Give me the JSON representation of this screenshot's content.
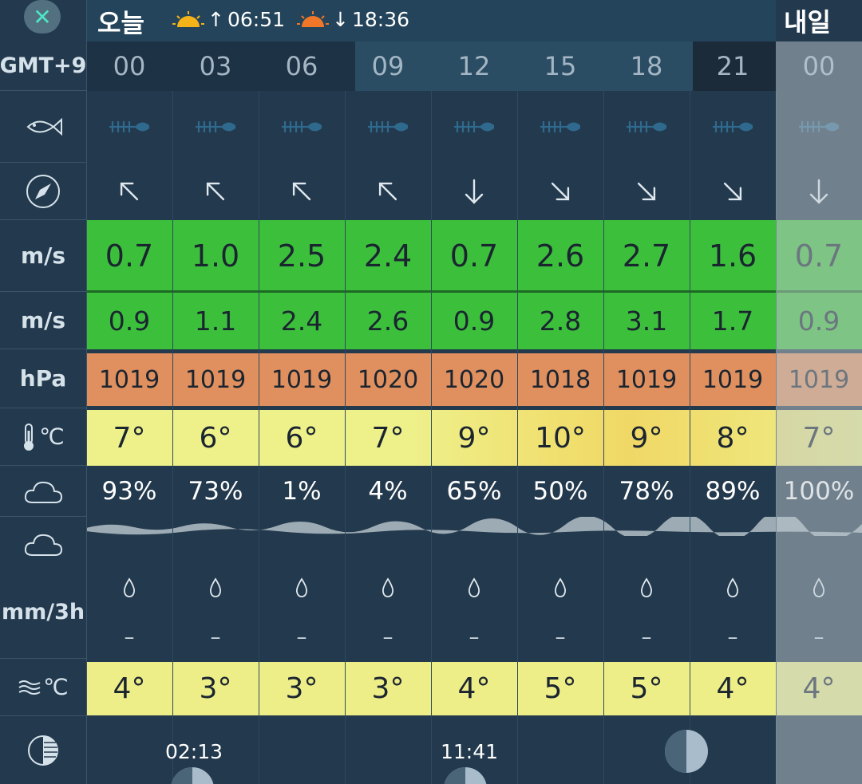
{
  "header": {
    "close_label": "✕",
    "today": "오늘",
    "sunrise": "06:51",
    "sunset": "18:36",
    "tomorrow": "내일"
  },
  "sidebar": {
    "timezone": "GMT+9",
    "wind_unit": "m/s",
    "gust_unit": "m/s",
    "pressure_unit": "hPa",
    "temp_unit": "℃",
    "precip_unit": "mm/3h",
    "water_temp_unit": "℃"
  },
  "hours": [
    "00",
    "03",
    "06",
    "09",
    "12",
    "15",
    "18",
    "21",
    "00"
  ],
  "wind_direction_icons": [
    "arrow-up-left",
    "arrow-up-left",
    "arrow-up-left",
    "arrow-up-left",
    "arrow-down",
    "arrow-down-right",
    "arrow-down-right",
    "arrow-down-right",
    "arrow-down"
  ],
  "wind_speed": [
    "0.7",
    "1.0",
    "2.5",
    "2.4",
    "0.7",
    "2.6",
    "2.7",
    "1.6",
    "0.7"
  ],
  "wind_gust": [
    "0.9",
    "1.1",
    "2.4",
    "2.6",
    "0.9",
    "2.8",
    "3.1",
    "1.7",
    "0.9"
  ],
  "pressure": [
    "1019",
    "1019",
    "1019",
    "1020",
    "1020",
    "1018",
    "1019",
    "1019",
    "1019"
  ],
  "temperature": [
    "7°",
    "6°",
    "6°",
    "7°",
    "9°",
    "10°",
    "9°",
    "8°",
    "7°"
  ],
  "cloud_cover": [
    "93%",
    "73%",
    "1%",
    "4%",
    "65%",
    "50%",
    "78%",
    "89%",
    "100%"
  ],
  "precipitation": [
    "–",
    "–",
    "–",
    "–",
    "–",
    "–",
    "–",
    "–",
    "–"
  ],
  "water_temperature": [
    "4°",
    "3°",
    "3°",
    "3°",
    "4°",
    "5°",
    "5°",
    "4°",
    "4°"
  ],
  "moon": {
    "moonrise": "02:13",
    "moonset": "11:41"
  },
  "colors": {
    "background": "#23394d",
    "wind_green": "#3cc03c",
    "pressure_orange": "#e0905e",
    "temp_yellow": "#eeee88"
  }
}
